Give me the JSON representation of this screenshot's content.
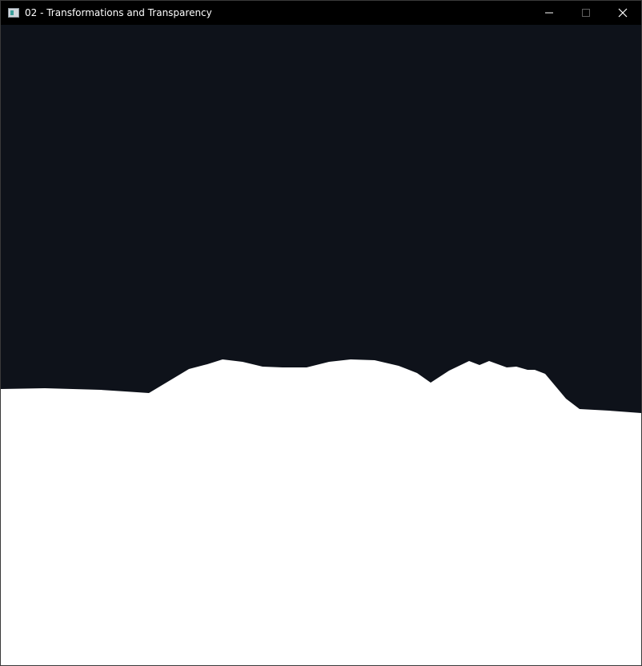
{
  "window": {
    "title": "02 - Transformations and Transparency",
    "icon": "app-window-icon",
    "controls": {
      "minimize_icon": "minimize-icon",
      "maximize_icon": "maximize-icon",
      "close_icon": "close-icon"
    }
  },
  "scene": {
    "background_color": "#0e121a",
    "terrain_color": "#ffffff",
    "titlebar_color": "#000000"
  }
}
